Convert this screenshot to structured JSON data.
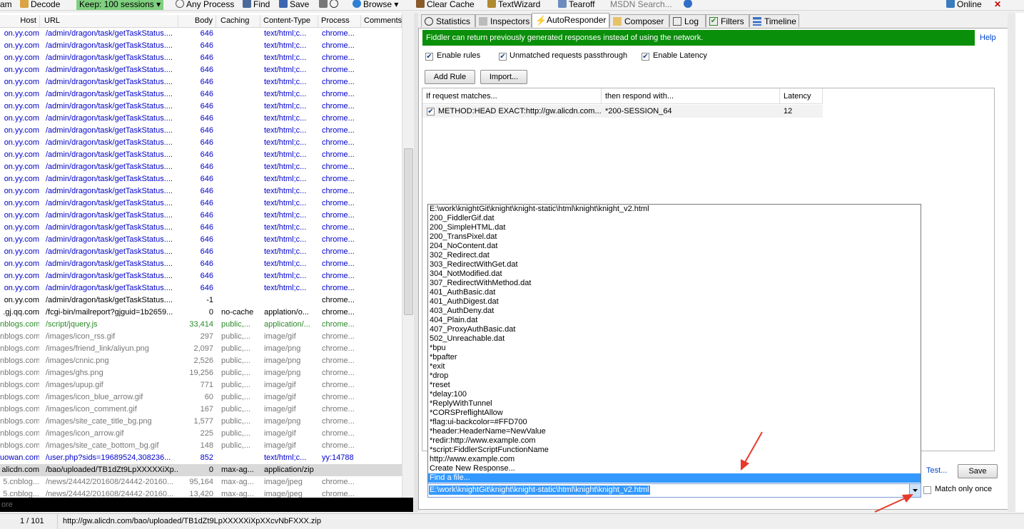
{
  "toolbar": {
    "items": [
      "am",
      "Decode",
      "Keep: 100 sessions",
      "Any Process",
      "Find",
      "Save",
      "Browse",
      "Clear Cache",
      "TextWizard",
      "Tearoff",
      "MSDN Search...",
      "Online"
    ]
  },
  "sessions": {
    "columns": [
      "Host",
      "URL",
      "Body",
      "Caching",
      "Content-Type",
      "Process",
      "Comments"
    ],
    "rows": [
      {
        "host": "on.yy.com",
        "url": "/admin/dragon/task/getTaskStatus....",
        "body": "646",
        "caching": "",
        "ct": "text/html;c...",
        "proc": "chrome...",
        "color": "blue"
      },
      {
        "host": "on.yy.com",
        "url": "/admin/dragon/task/getTaskStatus....",
        "body": "646",
        "caching": "",
        "ct": "text/html;c...",
        "proc": "chrome...",
        "color": "blue"
      },
      {
        "host": "on.yy.com",
        "url": "/admin/dragon/task/getTaskStatus....",
        "body": "646",
        "caching": "",
        "ct": "text/html;c...",
        "proc": "chrome...",
        "color": "blue"
      },
      {
        "host": "on.yy.com",
        "url": "/admin/dragon/task/getTaskStatus....",
        "body": "646",
        "caching": "",
        "ct": "text/html;c...",
        "proc": "chrome...",
        "color": "blue"
      },
      {
        "host": "on.yy.com",
        "url": "/admin/dragon/task/getTaskStatus....",
        "body": "646",
        "caching": "",
        "ct": "text/html;c...",
        "proc": "chrome...",
        "color": "blue"
      },
      {
        "host": "on.yy.com",
        "url": "/admin/dragon/task/getTaskStatus....",
        "body": "646",
        "caching": "",
        "ct": "text/html;c...",
        "proc": "chrome...",
        "color": "blue"
      },
      {
        "host": "on.yy.com",
        "url": "/admin/dragon/task/getTaskStatus....",
        "body": "646",
        "caching": "",
        "ct": "text/html;c...",
        "proc": "chrome...",
        "color": "blue"
      },
      {
        "host": "on.yy.com",
        "url": "/admin/dragon/task/getTaskStatus....",
        "body": "646",
        "caching": "",
        "ct": "text/html;c...",
        "proc": "chrome...",
        "color": "blue"
      },
      {
        "host": "on.yy.com",
        "url": "/admin/dragon/task/getTaskStatus....",
        "body": "646",
        "caching": "",
        "ct": "text/html;c...",
        "proc": "chrome...",
        "color": "blue"
      },
      {
        "host": "on.yy.com",
        "url": "/admin/dragon/task/getTaskStatus....",
        "body": "646",
        "caching": "",
        "ct": "text/html;c...",
        "proc": "chrome...",
        "color": "blue"
      },
      {
        "host": "on.yy.com",
        "url": "/admin/dragon/task/getTaskStatus....",
        "body": "646",
        "caching": "",
        "ct": "text/html;c...",
        "proc": "chrome...",
        "color": "blue"
      },
      {
        "host": "on.yy.com",
        "url": "/admin/dragon/task/getTaskStatus....",
        "body": "646",
        "caching": "",
        "ct": "text/html;c...",
        "proc": "chrome...",
        "color": "blue"
      },
      {
        "host": "on.yy.com",
        "url": "/admin/dragon/task/getTaskStatus....",
        "body": "646",
        "caching": "",
        "ct": "text/html;c...",
        "proc": "chrome...",
        "color": "blue"
      },
      {
        "host": "on.yy.com",
        "url": "/admin/dragon/task/getTaskStatus....",
        "body": "646",
        "caching": "",
        "ct": "text/html;c...",
        "proc": "chrome...",
        "color": "blue"
      },
      {
        "host": "on.yy.com",
        "url": "/admin/dragon/task/getTaskStatus....",
        "body": "646",
        "caching": "",
        "ct": "text/html;c...",
        "proc": "chrome...",
        "color": "blue"
      },
      {
        "host": "on.yy.com",
        "url": "/admin/dragon/task/getTaskStatus....",
        "body": "646",
        "caching": "",
        "ct": "text/html;c...",
        "proc": "chrome...",
        "color": "blue"
      },
      {
        "host": "on.yy.com",
        "url": "/admin/dragon/task/getTaskStatus....",
        "body": "646",
        "caching": "",
        "ct": "text/html;c...",
        "proc": "chrome...",
        "color": "blue"
      },
      {
        "host": "on.yy.com",
        "url": "/admin/dragon/task/getTaskStatus....",
        "body": "646",
        "caching": "",
        "ct": "text/html;c...",
        "proc": "chrome...",
        "color": "blue"
      },
      {
        "host": "on.yy.com",
        "url": "/admin/dragon/task/getTaskStatus....",
        "body": "646",
        "caching": "",
        "ct": "text/html;c...",
        "proc": "chrome...",
        "color": "blue"
      },
      {
        "host": "on.yy.com",
        "url": "/admin/dragon/task/getTaskStatus....",
        "body": "646",
        "caching": "",
        "ct": "text/html;c...",
        "proc": "chrome...",
        "color": "blue"
      },
      {
        "host": "on.yy.com",
        "url": "/admin/dragon/task/getTaskStatus....",
        "body": "646",
        "caching": "",
        "ct": "text/html;c...",
        "proc": "chrome...",
        "color": "blue"
      },
      {
        "host": "on.yy.com",
        "url": "/admin/dragon/task/getTaskStatus....",
        "body": "646",
        "caching": "",
        "ct": "text/html;c...",
        "proc": "chrome...",
        "color": "blue"
      },
      {
        "host": "on.yy.com",
        "url": "/admin/dragon/task/getTaskStatus....",
        "body": "-1",
        "caching": "",
        "ct": "",
        "proc": "chrome...",
        "color": "black"
      },
      {
        "host": ".gj.qq.com",
        "url": "/fcgi-bin/mailreport?gjguid=1b2659...",
        "body": "0",
        "caching": "no-cache",
        "ct": "applation/o...",
        "proc": "chrome...",
        "color": "black"
      },
      {
        "host": "nblogs.com",
        "url": "/script/jquery.js",
        "body": "33,414",
        "caching": "public,...",
        "ct": "application/...",
        "proc": "chrome...",
        "color": "green"
      },
      {
        "host": "nblogs.com",
        "url": "/images/icon_rss.gif",
        "body": "297",
        "caching": "public,...",
        "ct": "image/gif",
        "proc": "chrome...",
        "color": "gray"
      },
      {
        "host": "nblogs.com",
        "url": "/images/friend_link/aliyun.png",
        "body": "2,097",
        "caching": "public,...",
        "ct": "image/png",
        "proc": "chrome...",
        "color": "gray"
      },
      {
        "host": "nblogs.com",
        "url": "/images/cnnic.png",
        "body": "2,526",
        "caching": "public,...",
        "ct": "image/png",
        "proc": "chrome...",
        "color": "gray"
      },
      {
        "host": "nblogs.com",
        "url": "/images/ghs.png",
        "body": "19,256",
        "caching": "public,...",
        "ct": "image/png",
        "proc": "chrome...",
        "color": "gray"
      },
      {
        "host": "nblogs.com",
        "url": "/images/upup.gif",
        "body": "771",
        "caching": "public,...",
        "ct": "image/gif",
        "proc": "chrome...",
        "color": "gray"
      },
      {
        "host": "nblogs.com",
        "url": "/images/icon_blue_arrow.gif",
        "body": "60",
        "caching": "public,...",
        "ct": "image/gif",
        "proc": "chrome...",
        "color": "gray"
      },
      {
        "host": "nblogs.com",
        "url": "/images/icon_comment.gif",
        "body": "167",
        "caching": "public,...",
        "ct": "image/gif",
        "proc": "chrome...",
        "color": "gray"
      },
      {
        "host": "nblogs.com",
        "url": "/images/site_cate_title_bg.png",
        "body": "1,577",
        "caching": "public,...",
        "ct": "image/png",
        "proc": "chrome...",
        "color": "gray"
      },
      {
        "host": "nblogs.com",
        "url": "/images/icon_arrow.gif",
        "body": "225",
        "caching": "public,...",
        "ct": "image/gif",
        "proc": "chrome...",
        "color": "gray"
      },
      {
        "host": "nblogs.com",
        "url": "/images/site_cate_bottom_bg.gif",
        "body": "148",
        "caching": "public,...",
        "ct": "image/gif",
        "proc": "chrome...",
        "color": "gray"
      },
      {
        "host": "uowan.com",
        "url": "/user.php?sids=19689524,308236...",
        "body": "852",
        "caching": "",
        "ct": "text/html;c...",
        "proc": "yy:14788",
        "color": "blue"
      },
      {
        "host": "alicdn.com",
        "url": "/bao/uploaded/TB1dZt9LpXXXXXiXp...",
        "body": "0",
        "caching": "max-ag...",
        "ct": "application/zip",
        "proc": "",
        "color": "black",
        "selected": true
      },
      {
        "host": "5.cnblog...",
        "url": "/news/24442/201608/24442-20160...",
        "body": "95,164",
        "caching": "max-ag...",
        "ct": "image/jpeg",
        "proc": "chrome...",
        "color": "gray"
      },
      {
        "host": "5.cnblog...",
        "url": "/news/24442/201608/24442-20160...",
        "body": "13,420",
        "caching": "max-ag...",
        "ct": "image/jpeg",
        "proc": "chrome...",
        "color": "gray"
      }
    ]
  },
  "quickexec": {
    "placeholder": "ore"
  },
  "status": {
    "count": "1 / 101",
    "url": "http://gw.alicdn.com/bao/uploaded/TB1dZt9LpXXXXXiXpXXcvNbFXXX.zip"
  },
  "tabs": [
    "Statistics",
    "Inspectors",
    "AutoResponder",
    "Composer",
    "Log",
    "Filters",
    "Timeline"
  ],
  "autoresponder": {
    "banner": "Fiddler can return previously generated responses instead of using the network.",
    "help": "Help",
    "options": [
      "Enable rules",
      "Unmatched requests passthrough",
      "Enable Latency"
    ],
    "add_rule": "Add Rule",
    "import": "Import...",
    "columns": [
      "If request matches...",
      "then respond with...",
      "Latency"
    ],
    "rule": {
      "match": "METHOD:HEAD EXACT:http://gw.alicdn.com...",
      "respond": "*200-SESSION_64",
      "latency": "12"
    },
    "responses": [
      "E:\\work\\knightGit\\knight\\knight-static\\html\\knight\\knight_v2.html",
      "200_FiddlerGif.dat",
      "200_SimpleHTML.dat",
      "200_TransPixel.dat",
      "204_NoContent.dat",
      "302_Redirect.dat",
      "303_RedirectWithGet.dat",
      "304_NotModified.dat",
      "307_RedirectWithMethod.dat",
      "401_AuthBasic.dat",
      "401_AuthDigest.dat",
      "403_AuthDeny.dat",
      "404_Plain.dat",
      "407_ProxyAuthBasic.dat",
      "502_Unreachable.dat",
      "*bpu",
      "*bpafter",
      "*exit",
      "*drop",
      "*reset",
      "*delay:100",
      "*ReplyWithTunnel",
      "*CORSPreflightAllow",
      "*flag:ui-backcolor=#FFD700",
      "*header:HeaderName=NewValue",
      "*redir:http://www.example.com",
      "*script:FiddlerScriptFunctionName",
      "http://www.example.com",
      "Create New Response...",
      "Find a file..."
    ],
    "combo_value": "E:\\work\\knightGit\\knight\\knight-static\\html\\knight\\knight_v2.html",
    "test": "Test...",
    "save": "Save",
    "match_once": "Match only once"
  },
  "colors": {
    "banner": "#0a8f0a",
    "highlight": "#3399ff",
    "annotation": "#e8392a"
  }
}
